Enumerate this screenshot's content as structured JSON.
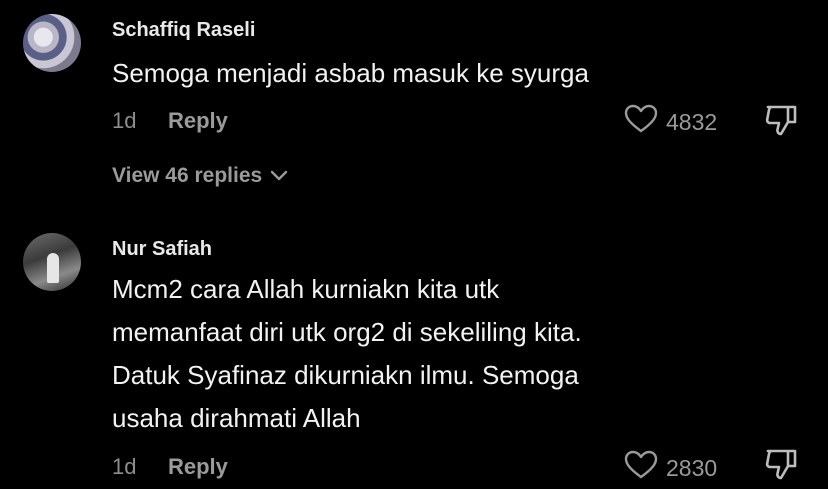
{
  "comments": [
    {
      "username": "Schaffiq Raseli",
      "text": "Semoga menjadi asbab masuk ke syurga",
      "time": "1d",
      "reply_label": "Reply",
      "likes": "4832",
      "view_replies": "View 46 replies"
    },
    {
      "username": "Nur Safiah",
      "text_lines": [
        "Mcm2 cara Allah kurniakn kita utk",
        "memanfaat diri utk org2 di sekeliling kita.",
        "Datuk Syafinaz dikurniakn ilmu. Semoga",
        "usaha dirahmati Allah"
      ],
      "time": "1d",
      "reply_label": "Reply",
      "likes": "2830"
    }
  ],
  "icons": {
    "like": "heart-outline-icon",
    "dislike": "thumbs-down-outline-icon",
    "expand": "chevron-down-icon"
  },
  "colors": {
    "background": "#000000",
    "secondary_text": "#9a9a9a"
  }
}
